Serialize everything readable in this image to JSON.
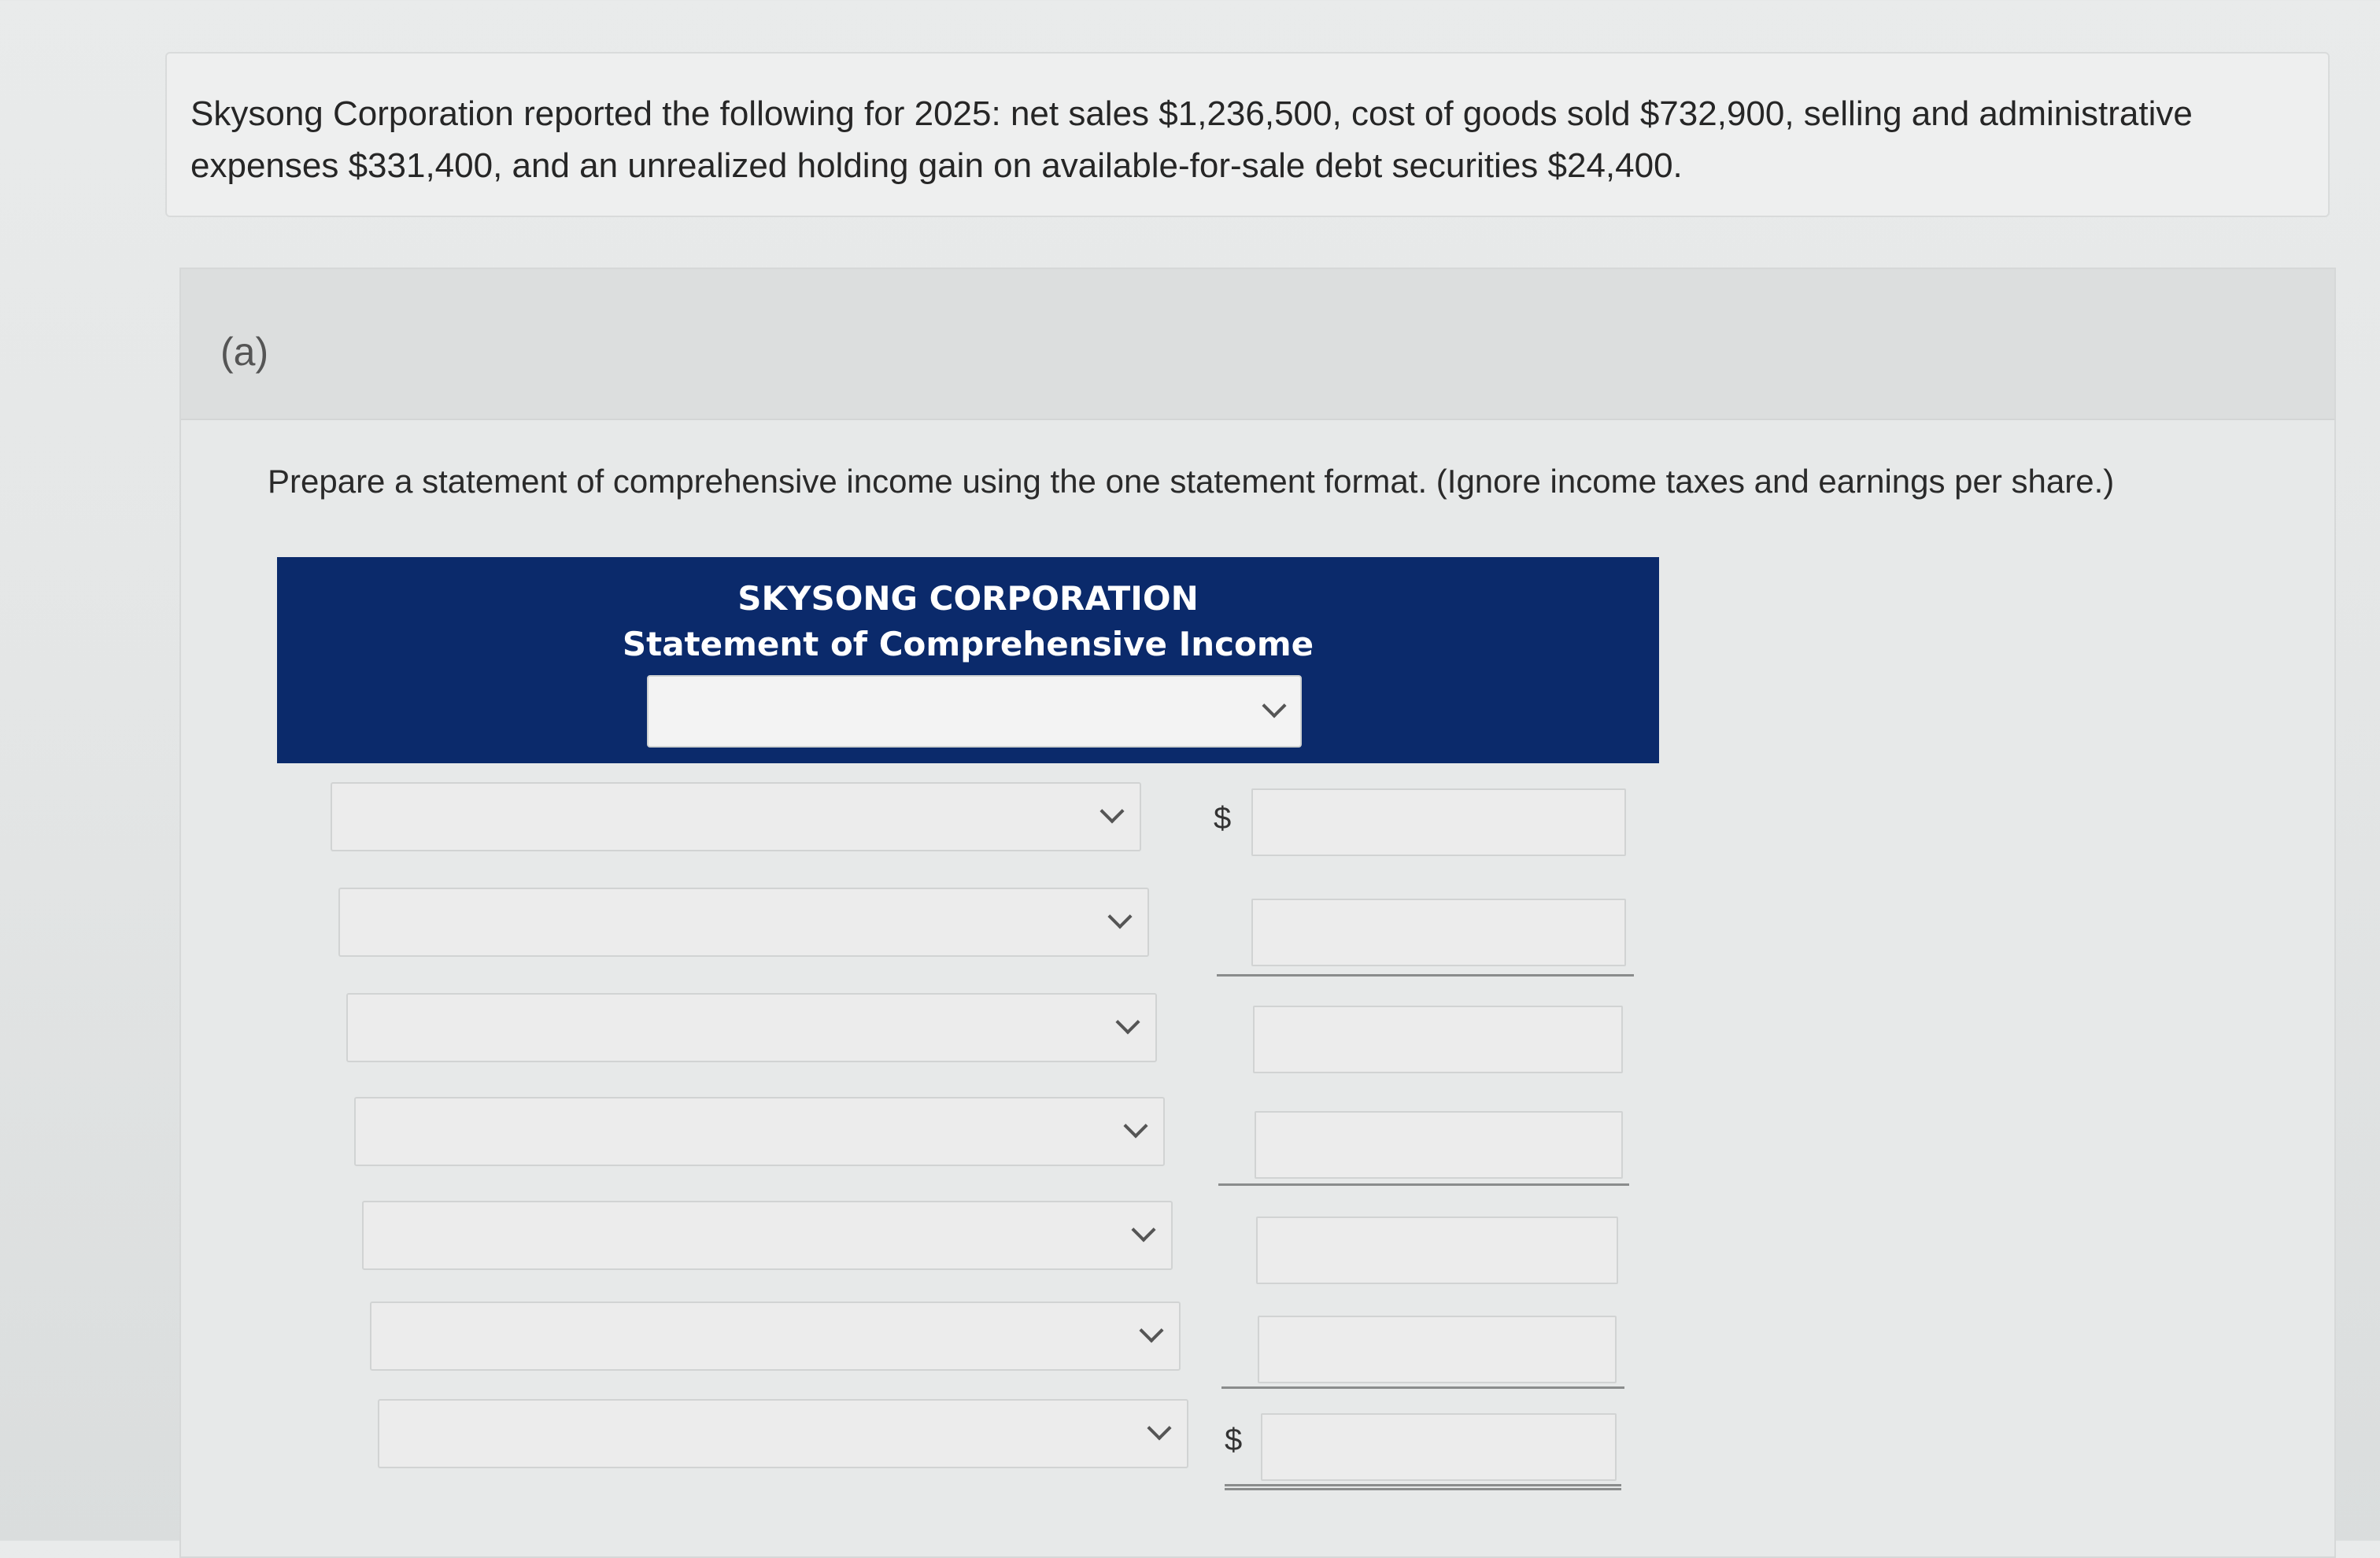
{
  "problem": {
    "line1": "Skysong Corporation reported the following for 2025: net sales $1,236,500, cost of goods sold $732,900, selling and administrative",
    "line2": "expenses $331,400, and an unrealized holding gain on available-for-sale debt securities $24,400."
  },
  "part": {
    "label": "(a)",
    "instruction": "Prepare a statement of comprehensive income using the one statement format. (Ignore income taxes and earnings per share.)"
  },
  "statement": {
    "company": "SKYSONG CORPORATION",
    "title": "Statement of Comprehensive Income",
    "period_value": ""
  },
  "rows": [
    {
      "account": "",
      "amount": "",
      "currency": "$"
    },
    {
      "account": "",
      "amount": ""
    },
    {
      "account": "",
      "amount": ""
    },
    {
      "account": "",
      "amount": ""
    },
    {
      "account": "",
      "amount": ""
    },
    {
      "account": "",
      "amount": ""
    },
    {
      "account": "",
      "amount": "",
      "currency": "$"
    }
  ],
  "icons": {
    "dropdown": "chevron-down-icon"
  }
}
